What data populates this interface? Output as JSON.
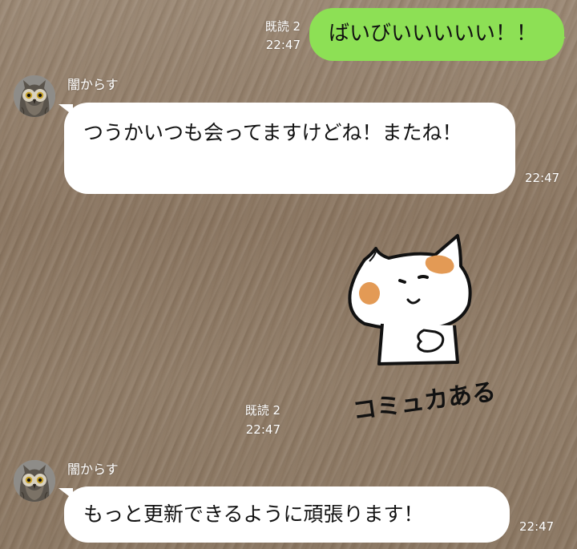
{
  "messages": [
    {
      "direction": "outgoing",
      "read_label": "既読 2",
      "time": "22:47",
      "text": "ばいびいいいいい！！"
    },
    {
      "direction": "incoming",
      "sender": "闇からす",
      "avatar_icon": "owl-avatar-icon",
      "text": "つうかいつも会ってますけどね！またね！",
      "time": "22:47"
    },
    {
      "direction": "outgoing",
      "type": "sticker",
      "sticker_icon": "cat-sticker-icon",
      "sticker_text": "コミュカある",
      "read_label": "既読 2",
      "time": "22:47"
    },
    {
      "direction": "incoming",
      "sender": "闇からす",
      "avatar_icon": "owl-avatar-icon",
      "text": "もっと更新できるように頑張ります！",
      "time": "22:47"
    }
  ],
  "colors": {
    "outgoing_bubble": "#8de055",
    "incoming_bubble": "#ffffff",
    "background": "#8d7a65",
    "sticker_patch": "#e39a55"
  }
}
